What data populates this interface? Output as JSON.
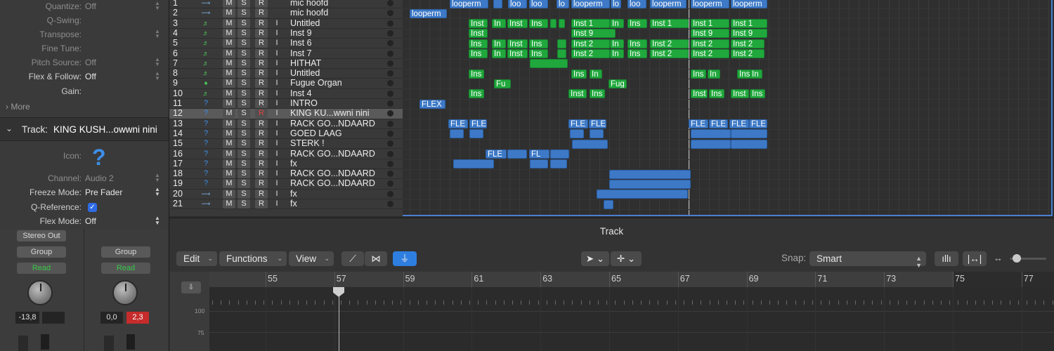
{
  "inspector": {
    "rows": [
      {
        "label": "Quantize:",
        "value": "Off"
      },
      {
        "label": "Q-Swing:",
        "value": ""
      },
      {
        "label": "Transpose:",
        "value": ""
      },
      {
        "label": "Fine Tune:",
        "value": ""
      },
      {
        "label": "Pitch Source:",
        "value": "Off"
      },
      {
        "label": "Flex & Follow:",
        "value": "Off"
      },
      {
        "label": "Gain:",
        "value": ""
      }
    ],
    "more_label": "More",
    "track_header": "Track:",
    "track_name": "KING KUSH...owwni nini",
    "track_rows": [
      {
        "label": "Icon:",
        "value": ""
      },
      {
        "label": "Channel:",
        "value": "Audio 2"
      },
      {
        "label": "Freeze Mode:",
        "value": "Pre Fader"
      },
      {
        "label": "Q-Reference:",
        "value": ""
      },
      {
        "label": "Flex Mode:",
        "value": "Off"
      }
    ],
    "strip1": {
      "top_button": "Stereo Out",
      "group": "Group",
      "read": "Read",
      "value": "-13,8"
    },
    "strip2": {
      "group": "Group",
      "read": "Read",
      "value": "0,0",
      "peak": "2,3"
    }
  },
  "tracks": [
    {
      "num": "1",
      "icon": "audio",
      "rec": false,
      "input": false,
      "name": "mic hoofd"
    },
    {
      "num": "2",
      "icon": "audio",
      "rec": false,
      "input": false,
      "name": "mic hoofd"
    },
    {
      "num": "3",
      "icon": "inst",
      "rec": false,
      "input": true,
      "name": "Untitled"
    },
    {
      "num": "4",
      "icon": "inst",
      "rec": false,
      "input": true,
      "name": "Inst 9"
    },
    {
      "num": "5",
      "icon": "inst",
      "rec": false,
      "input": true,
      "name": "Inst 6"
    },
    {
      "num": "6",
      "icon": "inst",
      "rec": false,
      "input": true,
      "name": "Inst 7"
    },
    {
      "num": "7",
      "icon": "inst",
      "rec": false,
      "input": true,
      "name": "HITHAT"
    },
    {
      "num": "8",
      "icon": "inst",
      "rec": false,
      "input": true,
      "name": "Untitled"
    },
    {
      "num": "9",
      "icon": "organ",
      "rec": false,
      "input": true,
      "name": "Fugue Organ"
    },
    {
      "num": "10",
      "icon": "inst",
      "rec": false,
      "input": true,
      "name": "Inst 4"
    },
    {
      "num": "11",
      "icon": "q",
      "rec": false,
      "input": true,
      "name": "INTRO"
    },
    {
      "num": "12",
      "icon": "q",
      "rec": true,
      "input": true,
      "name": "KING KU...wwni nini",
      "selected": true
    },
    {
      "num": "13",
      "icon": "q",
      "rec": false,
      "input": true,
      "name": "RACK GO...NDAARD"
    },
    {
      "num": "14",
      "icon": "q",
      "rec": false,
      "input": true,
      "name": "GOED LAAG"
    },
    {
      "num": "15",
      "icon": "q",
      "rec": false,
      "input": true,
      "name": "STERK !"
    },
    {
      "num": "16",
      "icon": "q",
      "rec": false,
      "input": true,
      "name": "RACK GO...NDAARD"
    },
    {
      "num": "17",
      "icon": "q",
      "rec": false,
      "input": true,
      "name": "fx"
    },
    {
      "num": "18",
      "icon": "q",
      "rec": false,
      "input": true,
      "name": "RACK GO...NDAARD"
    },
    {
      "num": "19",
      "icon": "q",
      "rec": false,
      "input": true,
      "name": "RACK GO...NDAARD"
    },
    {
      "num": "20",
      "icon": "audio",
      "rec": false,
      "input": true,
      "name": "fx"
    },
    {
      "num": "21",
      "icon": "audio",
      "rec": false,
      "input": true,
      "name": "fx"
    }
  ],
  "track_buttons": {
    "mute": "M",
    "solo": "S",
    "record": "R",
    "input": "I"
  },
  "regions": [
    [
      {
        "label": "looperm",
        "c": "blue"
      },
      {
        "label": "",
        "c": "blue"
      },
      {
        "label": "loo",
        "c": "blue"
      },
      {
        "label": "loo",
        "c": "blue"
      },
      {
        "label": "lo",
        "c": "blue"
      },
      {
        "label": "looperm",
        "c": "blue"
      },
      {
        "label": "lo",
        "c": "blue"
      },
      {
        "label": "loo",
        "c": "blue"
      },
      {
        "label": "looperm",
        "c": "blue"
      },
      {
        "label": "looperm",
        "c": "blue"
      },
      {
        "label": "looperm",
        "c": "blue"
      }
    ],
    [
      {
        "label": "looperm",
        "c": "blue"
      }
    ],
    [
      {
        "label": "Inst",
        "c": "green"
      },
      {
        "label": "In",
        "c": "green"
      },
      {
        "label": "Inst",
        "c": "green"
      },
      {
        "label": "Ins",
        "c": "green"
      },
      {
        "label": "",
        "c": "green"
      },
      {
        "label": "",
        "c": "green"
      },
      {
        "label": "Inst 1",
        "c": "green"
      },
      {
        "label": "In",
        "c": "green"
      },
      {
        "label": "Ins",
        "c": "green"
      },
      {
        "label": "Inst 1",
        "c": "green"
      },
      {
        "label": "Inst 1",
        "c": "green"
      },
      {
        "label": "Inst 1",
        "c": "green"
      }
    ],
    [
      {
        "label": "Inst",
        "c": "green"
      },
      {
        "label": "Inst 9",
        "c": "green"
      },
      {
        "label": "Inst 9",
        "c": "green"
      },
      {
        "label": "Inst 9",
        "c": "green"
      }
    ],
    [
      {
        "label": "Ins",
        "c": "green"
      },
      {
        "label": "In",
        "c": "green"
      },
      {
        "label": "Inst",
        "c": "green"
      },
      {
        "label": "Ins",
        "c": "green"
      },
      {
        "label": "",
        "c": "green"
      },
      {
        "label": "Inst 2",
        "c": "green"
      },
      {
        "label": "In",
        "c": "green"
      },
      {
        "label": "Ins",
        "c": "green"
      },
      {
        "label": "Inst 2",
        "c": "green"
      },
      {
        "label": "Inst 2",
        "c": "green"
      },
      {
        "label": "Inst 2",
        "c": "green"
      }
    ],
    [
      {
        "label": "Ins",
        "c": "green"
      },
      {
        "label": "In",
        "c": "green"
      },
      {
        "label": "Inst",
        "c": "green"
      },
      {
        "label": "Ins",
        "c": "green"
      },
      {
        "label": "",
        "c": "green"
      },
      {
        "label": "Inst 2",
        "c": "green"
      },
      {
        "label": "In",
        "c": "green"
      },
      {
        "label": "Ins",
        "c": "green"
      },
      {
        "label": "Inst 2",
        "c": "green"
      },
      {
        "label": "Inst 2",
        "c": "green"
      },
      {
        "label": "Inst 2",
        "c": "green"
      }
    ],
    [
      {
        "label": "",
        "c": "green"
      }
    ],
    [
      {
        "label": "Ins",
        "c": "green"
      },
      {
        "label": "Ins",
        "c": "green"
      },
      {
        "label": "In",
        "c": "green"
      },
      {
        "label": "Ins",
        "c": "green"
      },
      {
        "label": "In",
        "c": "green"
      },
      {
        "label": "Ins",
        "c": "green"
      },
      {
        "label": "In",
        "c": "green"
      }
    ],
    [
      {
        "label": "Fu",
        "c": "green"
      },
      {
        "label": "Fug",
        "c": "green"
      }
    ],
    [
      {
        "label": "Ins",
        "c": "green"
      },
      {
        "label": "Inst",
        "c": "green"
      },
      {
        "label": "Ins",
        "c": "green"
      },
      {
        "label": "Inst",
        "c": "green"
      },
      {
        "label": "Ins",
        "c": "green"
      },
      {
        "label": "Inst",
        "c": "green"
      },
      {
        "label": "Ins",
        "c": "green"
      }
    ],
    [
      {
        "label": "FLEX",
        "c": "blue"
      }
    ],
    [],
    [
      {
        "label": "FLE",
        "c": "blue"
      },
      {
        "label": "FLE",
        "c": "blue"
      },
      {
        "label": "FLE",
        "c": "blue"
      },
      {
        "label": "FLE",
        "c": "blue"
      },
      {
        "label": "FLE",
        "c": "blue"
      },
      {
        "label": "FLE",
        "c": "blue"
      },
      {
        "label": "FLE",
        "c": "blue"
      },
      {
        "label": "FLE",
        "c": "blue"
      }
    ],
    [
      {
        "label": "",
        "c": "blue"
      },
      {
        "label": "",
        "c": "blue"
      },
      {
        "label": "",
        "c": "blue"
      },
      {
        "label": "",
        "c": "blue"
      },
      {
        "label": "",
        "c": "blue"
      },
      {
        "label": "",
        "c": "blue"
      }
    ],
    [
      {
        "label": "",
        "c": "blue"
      },
      {
        "label": "",
        "c": "blue"
      },
      {
        "label": "",
        "c": "blue"
      }
    ],
    [
      {
        "label": "FLE",
        "c": "blue"
      },
      {
        "label": "",
        "c": "blue"
      },
      {
        "label": "FL",
        "c": "blue"
      },
      {
        "label": "",
        "c": "blue"
      }
    ],
    [
      {
        "label": "",
        "c": "blue"
      },
      {
        "label": "",
        "c": "blue"
      },
      {
        "label": "",
        "c": "blue"
      }
    ],
    [
      {
        "label": "",
        "c": "blue"
      }
    ],
    [
      {
        "label": "",
        "c": "blue"
      }
    ],
    [
      {
        "label": "",
        "c": "blue"
      },
      {
        "label": "",
        "c": "blue"
      }
    ],
    [
      {
        "label": "",
        "c": "blue"
      }
    ]
  ],
  "editor": {
    "title": "Track",
    "menus": [
      "Edit",
      "Functions",
      "View"
    ],
    "snap_label": "Snap:",
    "snap_value": "Smart",
    "bars": [
      "55",
      "57",
      "59",
      "61",
      "63",
      "65",
      "67",
      "69",
      "71",
      "73",
      "75",
      "77"
    ],
    "y_labels": [
      "100",
      "75"
    ]
  },
  "colors": {
    "region_blue": "#3d79c6",
    "region_green": "#20a83c",
    "accent": "#2e7ee0",
    "read": "#39c74a",
    "peak": "#c62c2c"
  }
}
